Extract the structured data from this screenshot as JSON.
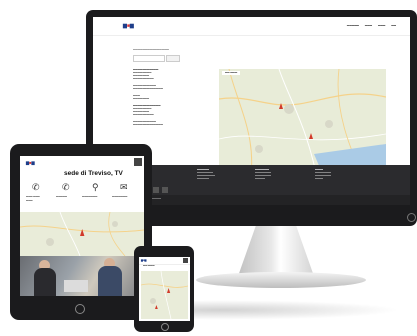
{
  "colors": {
    "brand_blue": "#1e3e8a",
    "brand_red": "#d33333",
    "device_frame": "#1b1b1d",
    "map_pin": "#d23a2a",
    "footer_bg": "#2b2b2e"
  },
  "tablet": {
    "heading": "sede di Treviso, TV"
  },
  "icons": [
    "phone-icon",
    "fax-icon",
    "map-pin-icon",
    "email-icon"
  ]
}
